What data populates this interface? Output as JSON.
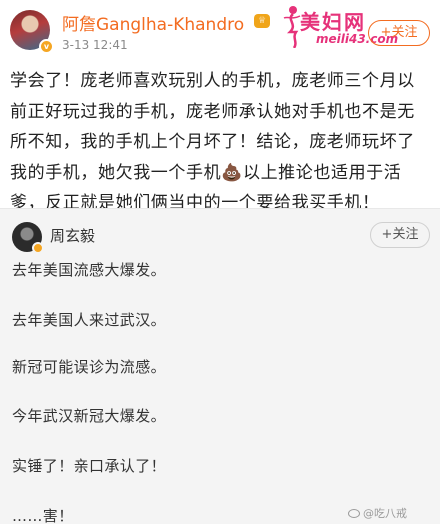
{
  "post": {
    "username": "阿詹Ganglha-Khandro",
    "medal": "🏅",
    "timestamp": "3-13 12:41",
    "follow_label": "+关注",
    "verified_mark": "v",
    "body": "学会了！庞老师喜欢玩别人的手机，庞老师三个月以前正好玩过我的手机，庞老师承认她对手机也不是无所不知，我的手机上个月坏了！结论，庞老师玩坏了我的手机，她欠我一个手机💩以上推论也适用于活爹，反正就是她们俩当中的一个要给我买手机！"
  },
  "watermark": {
    "brand": "美妇网",
    "site": "meili43.com"
  },
  "repost": {
    "username": "周玄毅",
    "follow_label": "+关注",
    "lines": [
      "去年美国流感大爆发。",
      "去年美国人来过武汉。",
      "新冠可能误诊为流感。",
      "今年武汉新冠大爆发。",
      "实锤了！亲口承认了！",
      "……害！"
    ],
    "weibo_watermark": "@吃八戒"
  },
  "colors": {
    "accent": "#f36c21",
    "watermark": "#e6327a",
    "repost_bg": "#f4f4f4"
  }
}
